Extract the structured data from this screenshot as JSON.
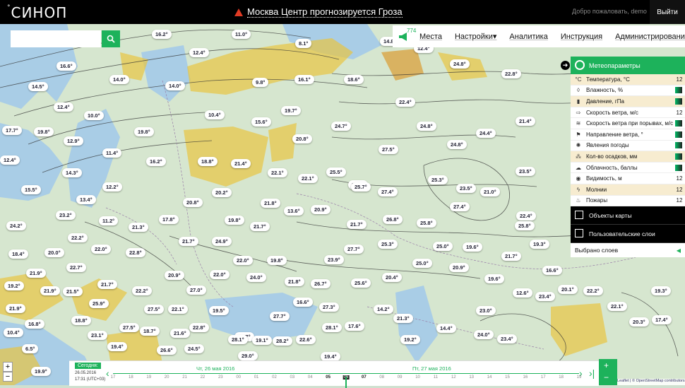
{
  "header": {
    "logo": "СИНОП",
    "logo_mark": "°",
    "alert_text": "Москва Центр прогнозируется Гроза",
    "welcome": "Добро пожаловать, demo",
    "logout": "Выйти"
  },
  "search": {
    "placeholder": "",
    "button_icon": "search-icon"
  },
  "menu": {
    "notification_count": "774",
    "items": [
      "Места",
      "Настройки",
      "Аналитика",
      "Инструкция",
      "Администрирование"
    ]
  },
  "panel": {
    "title": "Метеопараметры",
    "layers": [
      {
        "label": "Температура, °C",
        "value": "12",
        "icon": "°C"
      },
      {
        "label": "Влажность, %",
        "value": "",
        "icon": "◊"
      },
      {
        "label": "Давление, гПа",
        "value": "",
        "icon": "▮"
      },
      {
        "label": "Скорость ветра, м/с",
        "value": "12",
        "icon": "⇨"
      },
      {
        "label": "Скорость ветра при порывах, м/с",
        "value": "",
        "icon": "≋"
      },
      {
        "label": "Направление ветра, °",
        "value": "",
        "icon": "⚑"
      },
      {
        "label": "Явления погоды",
        "value": "",
        "icon": "✺"
      },
      {
        "label": "Кол-во осадков, мм",
        "value": "",
        "icon": "⁂"
      },
      {
        "label": "Облачность, баллы",
        "value": "",
        "icon": "☁"
      },
      {
        "label": "Видимость, м",
        "value": "12",
        "icon": "◉"
      },
      {
        "label": "Молнии",
        "value": "12",
        "icon": "ϟ"
      },
      {
        "label": "Пожары",
        "value": "12",
        "icon": "♨"
      }
    ],
    "map_objects": "Объекты карты",
    "user_layers": "Пользовательские слои",
    "selected_layers": "Выбрано слоев"
  },
  "temperatures": [
    "16.2°",
    "11.0°",
    "8.1°",
    "14.8°",
    "12.4°",
    "16.6°",
    "14.5°",
    "14.0°",
    "14.0°",
    "12.4°",
    "16.1°",
    "18.6°",
    "24.8°",
    "22.8°",
    "9.8°",
    "12.4°",
    "10.0°",
    "19.7°",
    "17.7°",
    "19.8°",
    "12.9°",
    "10.4°",
    "15.6°",
    "20.8°",
    "24.7°",
    "22.4°",
    "24.8°",
    "21.4°",
    "12.4°",
    "11.4°",
    "16.2°",
    "18.8°",
    "21.4°",
    "27.5°",
    "24.8°",
    "24.4°",
    "14.3°",
    "12.2°",
    "19.8°",
    "22.1°",
    "22.1°",
    "25.5°",
    "24.6°",
    "23.5°",
    "23.5°",
    "15.5°",
    "13.4°",
    "20.2°",
    "20.8°",
    "21.8°",
    "27.4°",
    "25.3°",
    "21.0°",
    "23.2°",
    "13.6°",
    "20.9°",
    "25.7°",
    "27.4°",
    "22.4°",
    "24.2°",
    "11.2°",
    "17.8°",
    "21.3°",
    "19.8°",
    "21.7°",
    "21.7°",
    "26.8°",
    "25.8°",
    "25.8°",
    "22.2°",
    "20.0°",
    "22.0°",
    "22.8°",
    "21.7°",
    "24.9°",
    "27.7°",
    "25.3°",
    "25.0°",
    "19.6°",
    "19.3°",
    "18.4°",
    "21.9°",
    "22.7°",
    "22.0°",
    "19.8°",
    "23.9°",
    "25.0°",
    "21.7°",
    "19.2°",
    "21.9°",
    "21.5°",
    "22.2°",
    "27.0°",
    "24.0°",
    "20.4°",
    "20.9°",
    "16.6°",
    "21.7°",
    "20.9°",
    "21.8°",
    "26.7°",
    "25.6°",
    "19.6°",
    "20.1°",
    "12.6°",
    "22.2°",
    "19.3°",
    "21.9°",
    "25.9°",
    "27.5°",
    "22.1°",
    "19.5°",
    "16.6°",
    "14.2°",
    "23.0°",
    "23.4°",
    "22.1°",
    "16.8°",
    "18.8°",
    "22.8°",
    "27.7°",
    "27.3°",
    "21.3°",
    "17.4°",
    "10.4°",
    "23.1°",
    "18.7°",
    "21.6°",
    "23.7°",
    "28.1°",
    "17.6°",
    "14.4°",
    "24.0°",
    "20.3°",
    "6.5°",
    "19.4°",
    "26.6°",
    "24.5°",
    "28.1°",
    "28.2°",
    "22.6°",
    "19.2°",
    "23.4°",
    "19.9°",
    "19.1°",
    "22.0°",
    "19.4°",
    "29.0°",
    "27.5°",
    "21.9°",
    "22.3°",
    "21.5°",
    "23.7°",
    "21.2°",
    "23.9°"
  ],
  "timeline": {
    "today_label": "Сегодня:",
    "today_date": "26.05.2016",
    "today_time": "17:31 (UTC+03)",
    "day1": "Чт, 26 мая 2016",
    "day2": "Пт, 27 мая 2016",
    "hours": [
      "17",
      "18",
      "19",
      "20",
      "21",
      "22",
      "23",
      "00",
      "01",
      "02",
      "03",
      "04",
      "05",
      "06",
      "07",
      "08",
      "09",
      "10",
      "11",
      "12",
      "13",
      "14",
      "15",
      "16",
      "17",
      "18",
      "19"
    ],
    "selected_hour": "18"
  },
  "attribution": "Leaflet | © OpenStreetMap contributors",
  "colors": {
    "accent": "#1db25b",
    "alert": "#e03b24",
    "storm_zone": "#e8c542"
  }
}
